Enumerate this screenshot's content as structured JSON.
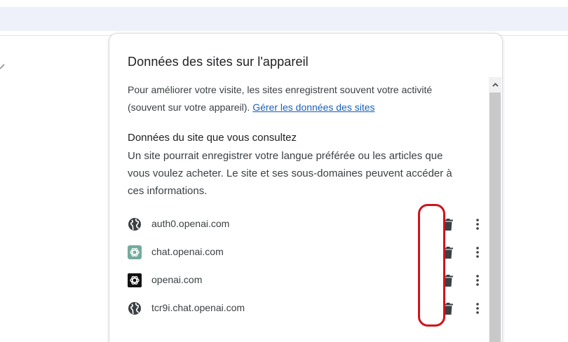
{
  "dialog": {
    "title": "Données des sites sur l'appareil",
    "intro_text": "Pour améliorer votre visite, les sites enregistrent souvent votre activité (souvent sur votre appareil). ",
    "intro_link": "Gérer les données des sites",
    "section_title": "Données du site que vous consultez",
    "section_desc": "Un site pourrait enregistrer votre langue préférée ou les articles que vous voulez acheter. Le site et ses sous-domaines peuvent accéder à ces informations."
  },
  "sites": [
    {
      "name": "auth0.openai.com",
      "icon": "globe-icon"
    },
    {
      "name": "chat.openai.com",
      "icon": "openai-favicon-green"
    },
    {
      "name": "openai.com",
      "icon": "openai-favicon-black"
    },
    {
      "name": "tcr9i.chat.openai.com",
      "icon": "globe-icon"
    }
  ],
  "colors": {
    "link": "#1a5fb4",
    "highlight": "#d0121b",
    "icon": "#3c4043",
    "openai_green": "#74aa9c"
  }
}
